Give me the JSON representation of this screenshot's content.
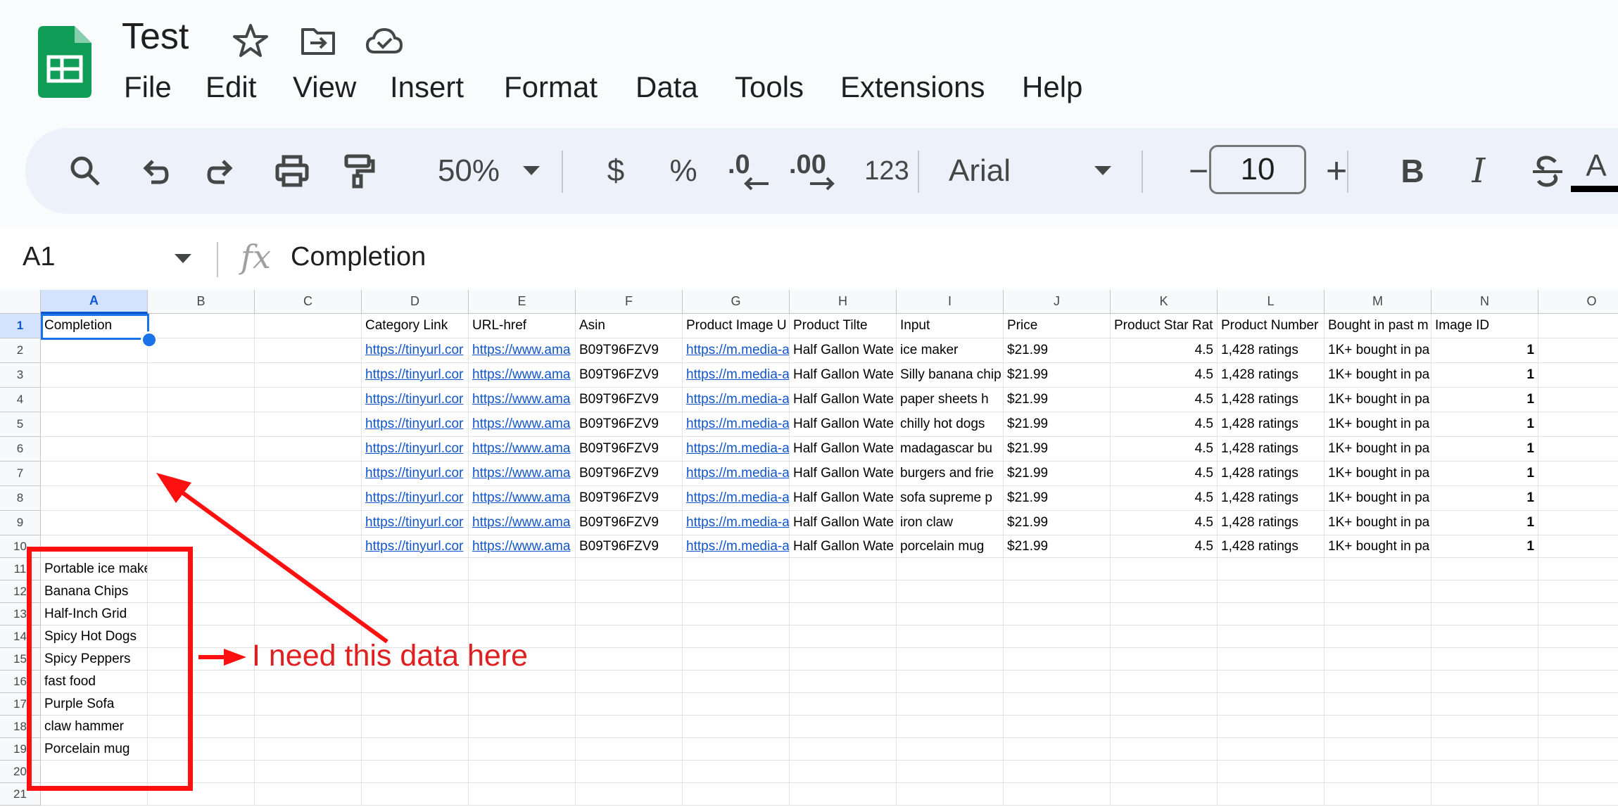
{
  "app": {
    "title": "Test",
    "menu": [
      "File",
      "Edit",
      "View",
      "Insert",
      "Format",
      "Data",
      "Tools",
      "Extensions",
      "Help"
    ]
  },
  "toolbar": {
    "zoom": "50%",
    "currency": "$",
    "percent": "%",
    "decrease_decimal": ".0",
    "increase_decimal": ".00",
    "number_format": "123",
    "font": "Arial",
    "font_size": "10",
    "minus": "−",
    "plus": "+",
    "bold": "B",
    "italic": "I",
    "text_color": "A"
  },
  "formula_bar": {
    "cell_ref": "A1",
    "fx": "fx",
    "content": "Completion"
  },
  "sheet": {
    "columns": [
      "A",
      "B",
      "C",
      "D",
      "E",
      "F",
      "G",
      "H",
      "I",
      "J",
      "K",
      "L",
      "M",
      "N",
      "O"
    ],
    "rows": [
      "1",
      "2",
      "3",
      "4",
      "5",
      "6",
      "7",
      "8",
      "9",
      "10",
      "11",
      "12",
      "13",
      "14",
      "15",
      "16",
      "17",
      "18",
      "19",
      "20",
      "21"
    ],
    "header_row": {
      "A": "Completion",
      "D": "Category Link",
      "E": "URL-href",
      "F": "Asin",
      "G": "Product Image U",
      "H": "Product Tilte",
      "I": "Input",
      "J": "Price",
      "K": "Product Star Rat",
      "L": "Product Number",
      "M": "Bought in past m",
      "N": "Image ID"
    },
    "data_rows": [
      {
        "D": "https://tinyurl.cor",
        "E": "https://www.ama",
        "F": "B09T96FZV9",
        "G": "https://m.media-a",
        "H": "Half Gallon Wate",
        "I": "ice maker",
        "J": "$21.99",
        "K": "4.5",
        "L": "1,428 ratings",
        "M": "1K+ bought in pa",
        "N": "1"
      },
      {
        "D": "https://tinyurl.cor",
        "E": "https://www.ama",
        "F": "B09T96FZV9",
        "G": "https://m.media-a",
        "H": "Half Gallon Wate",
        "I": "Silly banana chip",
        "J": "$21.99",
        "K": "4.5",
        "L": "1,428 ratings",
        "M": "1K+ bought in pa",
        "N": "1"
      },
      {
        "D": "https://tinyurl.cor",
        "E": "https://www.ama",
        "F": "B09T96FZV9",
        "G": "https://m.media-a",
        "H": "Half Gallon Wate",
        "I": "paper sheets h",
        "J": "$21.99",
        "K": "4.5",
        "L": "1,428 ratings",
        "M": "1K+ bought in pa",
        "N": "1"
      },
      {
        "D": "https://tinyurl.cor",
        "E": "https://www.ama",
        "F": "B09T96FZV9",
        "G": "https://m.media-a",
        "H": "Half Gallon Wate",
        "I": "chilly hot dogs",
        "J": "$21.99",
        "K": "4.5",
        "L": "1,428 ratings",
        "M": "1K+ bought in pa",
        "N": "1"
      },
      {
        "D": "https://tinyurl.cor",
        "E": "https://www.ama",
        "F": "B09T96FZV9",
        "G": "https://m.media-a",
        "H": "Half Gallon Wate",
        "I": "madagascar bu",
        "J": "$21.99",
        "K": "4.5",
        "L": "1,428 ratings",
        "M": "1K+ bought in pa",
        "N": "1"
      },
      {
        "D": "https://tinyurl.cor",
        "E": "https://www.ama",
        "F": "B09T96FZV9",
        "G": "https://m.media-a",
        "H": "Half Gallon Wate",
        "I": "burgers and frie",
        "J": "$21.99",
        "K": "4.5",
        "L": "1,428 ratings",
        "M": "1K+ bought in pa",
        "N": "1"
      },
      {
        "D": "https://tinyurl.cor",
        "E": "https://www.ama",
        "F": "B09T96FZV9",
        "G": "https://m.media-a",
        "H": "Half Gallon Wate",
        "I": "sofa supreme p",
        "J": "$21.99",
        "K": "4.5",
        "L": "1,428 ratings",
        "M": "1K+ bought in pa",
        "N": "1"
      },
      {
        "D": "https://tinyurl.cor",
        "E": "https://www.ama",
        "F": "B09T96FZV9",
        "G": "https://m.media-a",
        "H": "Half Gallon Wate",
        "I": "iron claw",
        "J": "$21.99",
        "K": "4.5",
        "L": "1,428 ratings",
        "M": "1K+ bought in pa",
        "N": "1"
      },
      {
        "D": "https://tinyurl.cor",
        "E": "https://www.ama",
        "F": "B09T96FZV9",
        "G": "https://m.media-a",
        "H": "Half Gallon Wate",
        "I": "porcelain mug",
        "J": "$21.99",
        "K": "4.5",
        "L": "1,428 ratings",
        "M": "1K+ bought in pa",
        "N": "1"
      }
    ],
    "column_a_values": [
      "Portable ice maker",
      "Banana Chips",
      "Half-Inch Grid",
      "Spicy Hot Dogs",
      "Spicy Peppers",
      "fast food",
      "Purple Sofa",
      "claw hammer",
      "Porcelain mug"
    ]
  },
  "annotation": {
    "text": "I need this data here",
    "color": "#ff1010"
  },
  "colors": {
    "accent": "#1a73e8",
    "link": "#1155cc",
    "sheets_green": "#0f9d58"
  }
}
